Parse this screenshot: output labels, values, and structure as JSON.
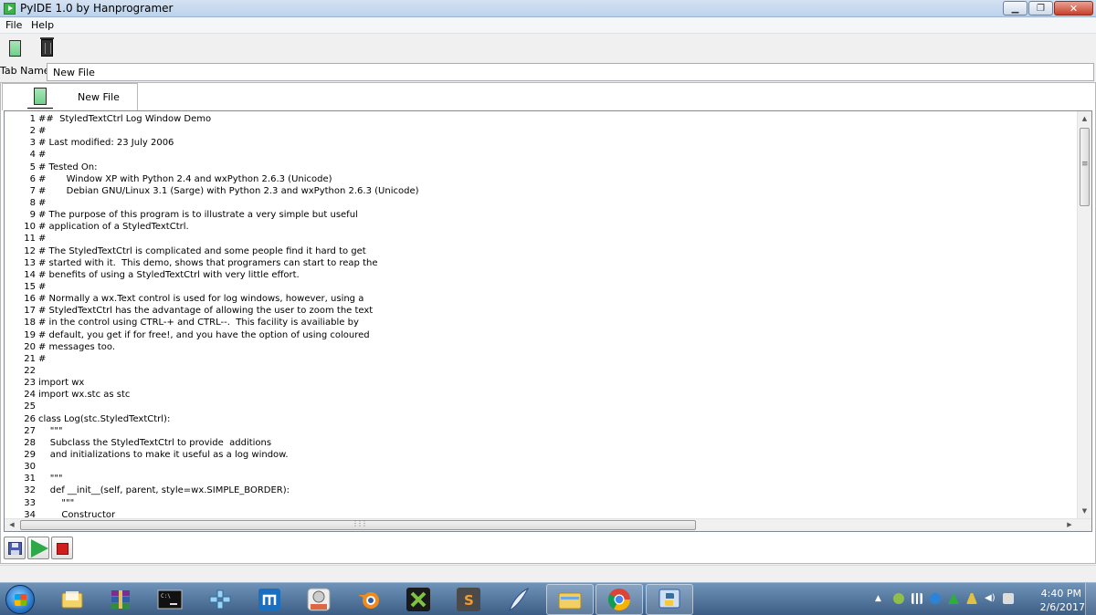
{
  "window": {
    "title": "PyIDE 1.0 by Hanprogramer"
  },
  "menu": {
    "file": "File",
    "help": "Help"
  },
  "toolbar": {
    "new_icon": "new-file-icon",
    "delete_icon": "trash-icon"
  },
  "tab_name": {
    "label": "Tab Name:",
    "value": "New File"
  },
  "tabs": [
    {
      "label": "New File",
      "icon": "file-icon"
    }
  ],
  "editor": {
    "lines": [
      {
        "n": "1",
        "t": "##  StyledTextCtrl Log Window Demo"
      },
      {
        "n": "2",
        "t": "#"
      },
      {
        "n": "3",
        "t": "# Last modified: 23 July 2006"
      },
      {
        "n": "4",
        "t": "#"
      },
      {
        "n": "5",
        "t": "# Tested On:"
      },
      {
        "n": "6",
        "t": "#       Window XP with Python 2.4 and wxPython 2.6.3 (Unicode)"
      },
      {
        "n": "7",
        "t": "#       Debian GNU/Linux 3.1 (Sarge) with Python 2.3 and wxPython 2.6.3 (Unicode)"
      },
      {
        "n": "8",
        "t": "#"
      },
      {
        "n": "9",
        "t": "# The purpose of this program is to illustrate a very simple but useful"
      },
      {
        "n": "10",
        "t": "# application of a StyledTextCtrl."
      },
      {
        "n": "11",
        "t": "#"
      },
      {
        "n": "12",
        "t": "# The StyledTextCtrl is complicated and some people find it hard to get"
      },
      {
        "n": "13",
        "t": "# started with it.  This demo, shows that programers can start to reap the"
      },
      {
        "n": "14",
        "t": "# benefits of using a StyledTextCtrl with very little effort."
      },
      {
        "n": "15",
        "t": "#"
      },
      {
        "n": "16",
        "t": "# Normally a wx.Text control is used for log windows, however, using a"
      },
      {
        "n": "17",
        "t": "# StyledTextCtrl has the advantage of allowing the user to zoom the text"
      },
      {
        "n": "18",
        "t": "# in the control using CTRL-+ and CTRL--.  This facility is availiable by"
      },
      {
        "n": "19",
        "t": "# default, you get if for free!, and you have the option of using coloured"
      },
      {
        "n": "20",
        "t": "# messages too."
      },
      {
        "n": "21",
        "t": "#"
      },
      {
        "n": "22",
        "t": ""
      },
      {
        "n": "23",
        "t": "import wx"
      },
      {
        "n": "24",
        "t": "import wx.stc as stc"
      },
      {
        "n": "25",
        "t": ""
      },
      {
        "n": "26",
        "t": "class Log(stc.StyledTextCtrl):"
      },
      {
        "n": "27",
        "t": "    \"\"\""
      },
      {
        "n": "28",
        "t": "    Subclass the StyledTextCtrl to provide  additions"
      },
      {
        "n": "29",
        "t": "    and initializations to make it useful as a log window."
      },
      {
        "n": "30",
        "t": ""
      },
      {
        "n": "31",
        "t": "    \"\"\""
      },
      {
        "n": "32",
        "t": "    def __init__(self, parent, style=wx.SIMPLE_BORDER):"
      },
      {
        "n": "33",
        "t": "        \"\"\""
      },
      {
        "n": "34",
        "t": "        Constructor"
      }
    ]
  },
  "buttons": {
    "save_icon": "save-icon",
    "run_icon": "play-icon",
    "stop_icon": "stop-icon"
  },
  "taskbar": {
    "apps": [
      {
        "name": "explorer-icon"
      },
      {
        "name": "winrar-icon"
      },
      {
        "name": "cmd-icon"
      },
      {
        "name": "ppsspp-icon"
      },
      {
        "name": "maxthon-icon"
      },
      {
        "name": "trashmule-icon"
      },
      {
        "name": "blender-icon"
      },
      {
        "name": "xampp-icon"
      },
      {
        "name": "sublime-text-icon"
      },
      {
        "name": "inkscape-icon"
      },
      {
        "name": "file-explorer-icon"
      },
      {
        "name": "chrome-icon"
      },
      {
        "name": "python-icon"
      }
    ],
    "clock": {
      "time": "4:40 PM",
      "date": "2/6/2017"
    }
  }
}
